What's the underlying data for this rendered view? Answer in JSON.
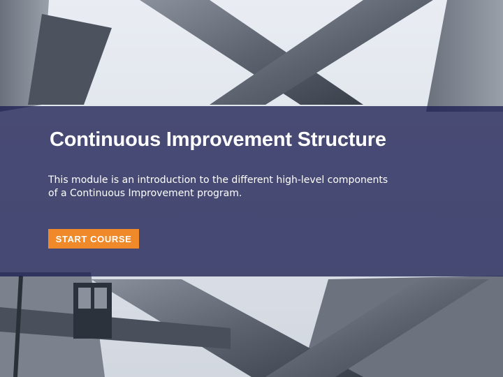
{
  "hero": {
    "title": "Continuous Improvement Structure",
    "description": "This module is an introduction to the different high-level components of a Continuous Improvement program."
  },
  "actions": {
    "start_label": "START COURSE"
  },
  "colors": {
    "overlay": "#1c1f52",
    "accent": "#f0892a",
    "text": "#ffffff"
  }
}
